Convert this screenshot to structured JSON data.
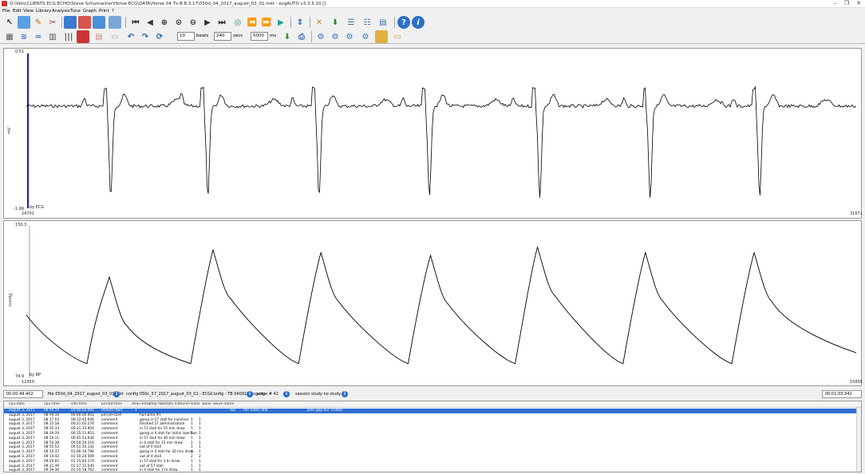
{
  "window": {
    "title": "Q:\\Vets\\CLIENTS ECG ECHO\\Steve Schumacher\\Horse ECG\\DATA\\Horse 04 Tx B 8.3.17\\050d_04_2017_august_03_01.mkt - ecgAUTO  v3.3.5.10 []"
  },
  "menu": [
    "File",
    "Edit",
    "View",
    "Library",
    "Analysis",
    "Tune",
    "Graph",
    "Print",
    "?"
  ],
  "toolbar": {
    "beats_value": "10",
    "beats_label": "beats",
    "secs_value": "240",
    "secs_label": "secs",
    "ms_value": "5000",
    "ms_label": "ms"
  },
  "ecg_chart": {
    "y_max": "0.51",
    "y_min": "-1.99",
    "y_label": "mV",
    "x_start": "24701",
    "x_end": "31671",
    "channel_label": "by ECG",
    "ylim": [
      -1.99,
      0.51
    ],
    "beats_at_x": [
      0.095,
      0.212,
      0.346,
      0.479,
      0.612,
      0.745,
      0.877
    ],
    "line_color": "#000000",
    "cursor_color": "#1a1aa8"
  },
  "bp_chart": {
    "y_max": "130.3",
    "y_min": "74.9",
    "y_label": "mmHg",
    "x_start": "12350",
    "x_end": "15835",
    "channel_label": "by BP",
    "ylim": [
      74.9,
      130.3
    ],
    "peaks": [
      {
        "x": 0.1,
        "y": 112
      },
      {
        "x": 0.225,
        "y": 122
      },
      {
        "x": 0.355,
        "y": 121
      },
      {
        "x": 0.487,
        "y": 120
      },
      {
        "x": 0.616,
        "y": 123
      },
      {
        "x": 0.746,
        "y": 121
      },
      {
        "x": 0.877,
        "y": 121
      }
    ],
    "line_color": "#000000"
  },
  "status": {
    "elapsed": "00:00:49.402",
    "file": "file  050d_04_2017_august_03_01.mkt",
    "config": "config  050c_57_2017_august_03_01 - ECGConfig - TB 040919.ecg.cfg",
    "wave": "wave #  42",
    "session": "session study  no study",
    "end_time": "00:01:03.342"
  },
  "table": {
    "columns": [
      "cpu-date",
      "cpu-time",
      "site-time",
      "period-time",
      "step-index",
      "step-label",
      "abs-index",
      "rel-index",
      "wave",
      "wave-name"
    ],
    "selected_extra": [
      "dur",
      "hhr 43mn 4hb",
      "prev gap dur",
      "0.000s"
    ],
    "rows": [
      {
        "date": "august  3, 2017",
        "time": "08  04  16",
        "site": "00:00:00.000",
        "period": "stream-start",
        "step": "1",
        "label": "",
        "abs": "",
        "rel": ""
      },
      {
        "date": "august  3, 2017",
        "time": "08  04  16",
        "site": "00:00:00.001",
        "period": "period-start",
        "step": "",
        "label": "horname #1",
        "abs": "",
        "rel": ""
      },
      {
        "date": "august  3, 2017",
        "time": "08  17  03",
        "site": "00:12:45.046",
        "period": "comment",
        "step": "",
        "label": "going in 57 stall for injection",
        "abs": "1",
        "rel": "1"
      },
      {
        "date": "august  3, 2017",
        "time": "08  25  18",
        "site": "00:21:02.276",
        "period": "comment",
        "step": "",
        "label": "finished 57 administration",
        "abs": "1",
        "rel": "1"
      },
      {
        "date": "august  3, 2017",
        "time": "08  35  33",
        "site": "00:31:15.954",
        "period": "comment",
        "step": "",
        "label": "in 57 stall for 15 min draw",
        "abs": "1",
        "rel": "1"
      },
      {
        "date": "august  3, 2017",
        "time": "08  39  29",
        "site": "00:35:11.953",
        "period": "comment",
        "step": "",
        "label": "going in 4 stall for initial injection",
        "abs": "1",
        "rel": "1"
      },
      {
        "date": "august  3, 2017",
        "time": "08  50  11",
        "site": "00:45:53.630",
        "period": "comment",
        "step": "",
        "label": "in 57 stall for 30 min draw",
        "abs": "1",
        "rel": "1"
      },
      {
        "date": "august  3, 2017",
        "time": "08  54  38",
        "site": "00:50:20.316",
        "period": "comment",
        "step": "",
        "label": "in 4 stall for 15 min draw",
        "abs": "1",
        "rel": "1"
      },
      {
        "date": "august  3, 2017",
        "time": "08  55  53",
        "site": "00:51:35.142",
        "period": "comment",
        "step": "",
        "label": "out of 4 stall",
        "abs": "1",
        "rel": "1"
      },
      {
        "date": "august  3, 2017",
        "time": "09  10  37",
        "site": "01:06:19.796",
        "period": "comment",
        "step": "",
        "label": "going in 4 stall for 30 min draw",
        "abs": "1",
        "rel": "1"
      },
      {
        "date": "august  3, 2017",
        "time": "09  14  42",
        "site": "01:10:24.569",
        "period": "comment",
        "step": "",
        "label": "out of 4 stall",
        "abs": "2",
        "rel": "2"
      },
      {
        "date": "august  3, 2017",
        "time": "09  20  02",
        "site": "01:15:44.174",
        "period": "comment",
        "step": "",
        "label": "in 57 stall for 1 hr draw",
        "abs": "1",
        "rel": "1"
      },
      {
        "date": "august  3, 2017",
        "time": "09  21  49",
        "site": "01:17:31.540",
        "period": "comment",
        "step": "",
        "label": "out of 57 stall",
        "abs": "1",
        "rel": "1"
      },
      {
        "date": "august  3, 2017",
        "time": "09  39  36",
        "site": "01:35:18.762",
        "period": "comment",
        "step": "",
        "label": "in 4 stall for 1 hr draw",
        "abs": "1",
        "rel": "1"
      }
    ]
  }
}
